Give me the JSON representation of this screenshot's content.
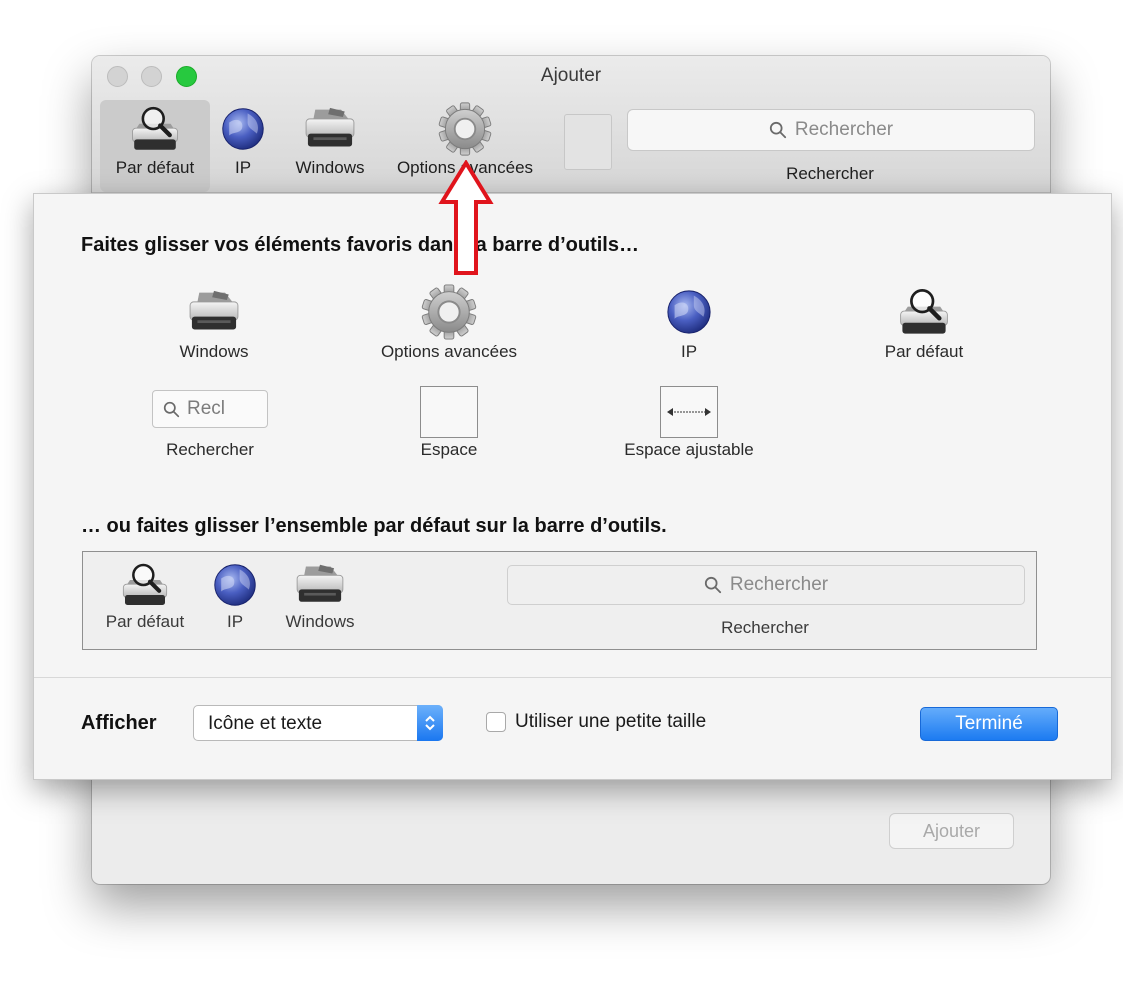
{
  "window": {
    "title": "Ajouter",
    "add_button": "Ajouter"
  },
  "toolbar": {
    "items": [
      {
        "label": "Par défaut",
        "icon": "default-printer-icon",
        "selected": true
      },
      {
        "label": "IP",
        "icon": "globe-icon"
      },
      {
        "label": "Windows",
        "icon": "printer-icon"
      },
      {
        "label": "Options avancées",
        "icon": "gear-icon"
      }
    ],
    "search_placeholder": "Rechercher",
    "search_label": "Rechercher"
  },
  "sheet": {
    "heading_favorites": "Faites glisser vos éléments favoris dans la barre d’outils…",
    "palette": [
      {
        "label": "Windows",
        "icon": "printer-icon"
      },
      {
        "label": "Options avancées",
        "icon": "gear-icon"
      },
      {
        "label": "IP",
        "icon": "globe-icon"
      },
      {
        "label": "Par défaut",
        "icon": "default-printer-icon"
      },
      {
        "label": "Rechercher",
        "icon": "search-field",
        "preview_text": "Recl"
      },
      {
        "label": "Espace",
        "icon": "space-icon"
      },
      {
        "label": "Espace ajustable",
        "icon": "flexible-space-icon"
      }
    ],
    "heading_default_set": "… ou faites glisser l’ensemble par défaut sur la barre d’outils.",
    "default_set": {
      "items": [
        "Par défaut",
        "IP",
        "Windows"
      ],
      "search_placeholder": "Rechercher",
      "search_label": "Rechercher"
    },
    "show_label": "Afficher",
    "show_value": "Icône et texte",
    "small_size_label": "Utiliser une petite taille",
    "small_size_checked": false,
    "done_button": "Terminé"
  },
  "colors": {
    "accent_blue": "#1c7bf1",
    "annotation_red": "#e0141c",
    "traffic_green": "#27c93f"
  }
}
